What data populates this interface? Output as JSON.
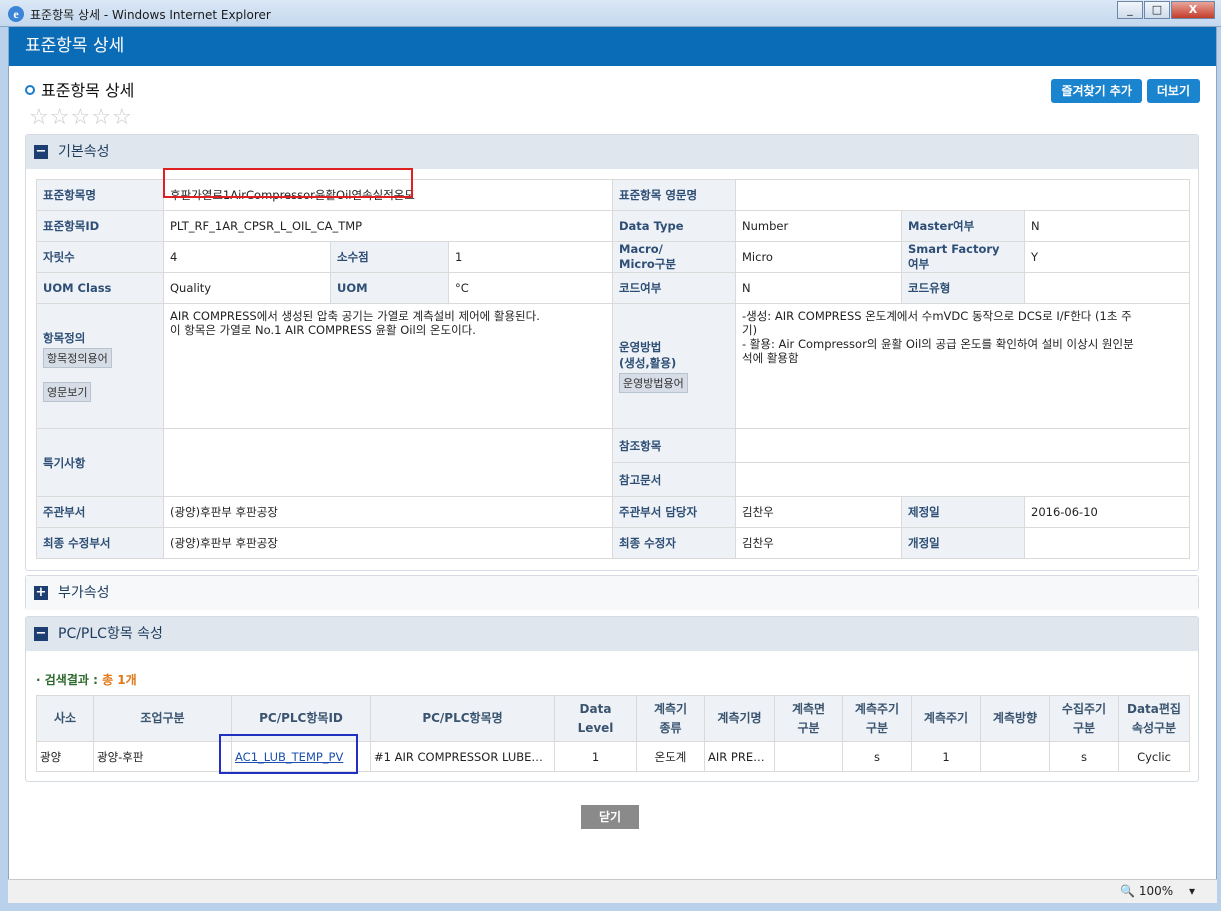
{
  "window": {
    "title": "표준항목 상세 - Windows Internet Explorer",
    "min": "_",
    "max": "□",
    "close": "X"
  },
  "header": {
    "title": "표준항목 상세"
  },
  "page": {
    "title": "표준항목 상세"
  },
  "rating": {
    "stars": [
      "☆",
      "☆",
      "☆",
      "☆",
      "☆"
    ],
    "value": 0
  },
  "buttons": {
    "favorite": "즐겨찾기 추가",
    "more": "더보기",
    "close": "닫기"
  },
  "basic": {
    "section_title": "기본속성",
    "toggle": "−",
    "rows": {
      "std_name_label": "표준항목명",
      "std_name": "후판가열로1AirCompressor윤활Oil연속실적온도",
      "eng_name_label": "표준항목 영문명",
      "eng_name": "",
      "std_id_label": "표준항목ID",
      "std_id": "PLT_RF_1AR_CPSR_L_OIL_CA_TMP",
      "datatype_label": "Data Type",
      "datatype": "Number",
      "master_label": "Master여부",
      "master": "N",
      "digits_label": "자릿수",
      "digits": "4",
      "decimal_label": "소수점",
      "decimal": "1",
      "macro_label_1": "Macro/",
      "macro_label_2": "Micro구분",
      "macro": "Micro",
      "sf_label_1": "Smart Factory",
      "sf_label_2": "여부",
      "sf": "Y",
      "uom_class_label": "UOM Class",
      "uom_class": "Quality",
      "uom_label": "UOM",
      "uom": "°C",
      "code_yn_label": "코드여부",
      "code_yn": "N",
      "code_type_label": "코드유형",
      "code_type": "",
      "def_label": "항목정의",
      "def_term_btn": "항목정의용어",
      "def_eng_btn": "영문보기",
      "def_line1": "AIR COMPRESS에서 생성된 압축 공기는 가열로 계측설비 제어에 활용된다.",
      "def_line2": "이 항목은 가열로 No.1 AIR COMPRESS 윤활 Oil의 온도이다.",
      "op_label_1": "운영방법",
      "op_label_2": "(생성,활용)",
      "op_term_btn": "운영방법용어",
      "op_line1": "-생성: AIR COMPRESS 온도계에서 수mVDC 동작으로 DCS로 I/F한다 (1초 주",
      "op_line2": "기)",
      "op_line3": "- 활용: Air Compressor의 윤활 Oil의 공급 온도를 확인하여 설비 이상시 원인분",
      "op_line4": "석에 활용함",
      "special_label": "특기사항",
      "special": "",
      "ref_item_label": "참조항목",
      "ref_item": "",
      "ref_doc_label": "참고문서",
      "ref_doc": "",
      "dept_label": "주관부서",
      "dept": "(광양)후판부 후판공장",
      "dept_mgr_label": "주관부서 담당자",
      "dept_mgr": "김찬우",
      "enact_label": "제정일",
      "enact": "2016-06-10",
      "last_dept_label": "최종 수정부서",
      "last_dept": "(광양)후판부 후판공장",
      "last_editor_label": "최종 수정자",
      "last_editor": "김찬우",
      "revise_label": "개정일",
      "revise": ""
    }
  },
  "extra": {
    "section_title": "부가속성",
    "toggle": "+"
  },
  "plc": {
    "section_title": "PC/PLC항목 속성",
    "toggle": "−",
    "result_label": "· 검색결과 :",
    "result_count": "총 1개",
    "columns": [
      [
        "사소"
      ],
      [
        "조업구분"
      ],
      [
        "PC/PLC항목ID"
      ],
      [
        "PC/PLC항목명"
      ],
      [
        "Data",
        "Level"
      ],
      [
        "계측기",
        "종류"
      ],
      [
        "계측기명"
      ],
      [
        "계측면",
        "구분"
      ],
      [
        "계측주기",
        "구분"
      ],
      [
        "계측주기"
      ],
      [
        "계측방향"
      ],
      [
        "수집주기",
        "구분"
      ],
      [
        "Data편집",
        "속성구분"
      ]
    ],
    "row": {
      "site": "광양",
      "op": "광양-후판",
      "id": "AC1_LUB_TEMP_PV",
      "name": "#1 AIR COMPRESSOR LUBE…",
      "level": "1",
      "meter_type": "온도계",
      "meter_name": "AIR PRE…",
      "side": "",
      "cycle_type": "s",
      "cycle": "1",
      "direction": "",
      "collect_type": "s",
      "edit_type": "Cyclic"
    }
  },
  "status": {
    "zoom": "100%",
    "zoom_icon": "magnifier-icon"
  }
}
